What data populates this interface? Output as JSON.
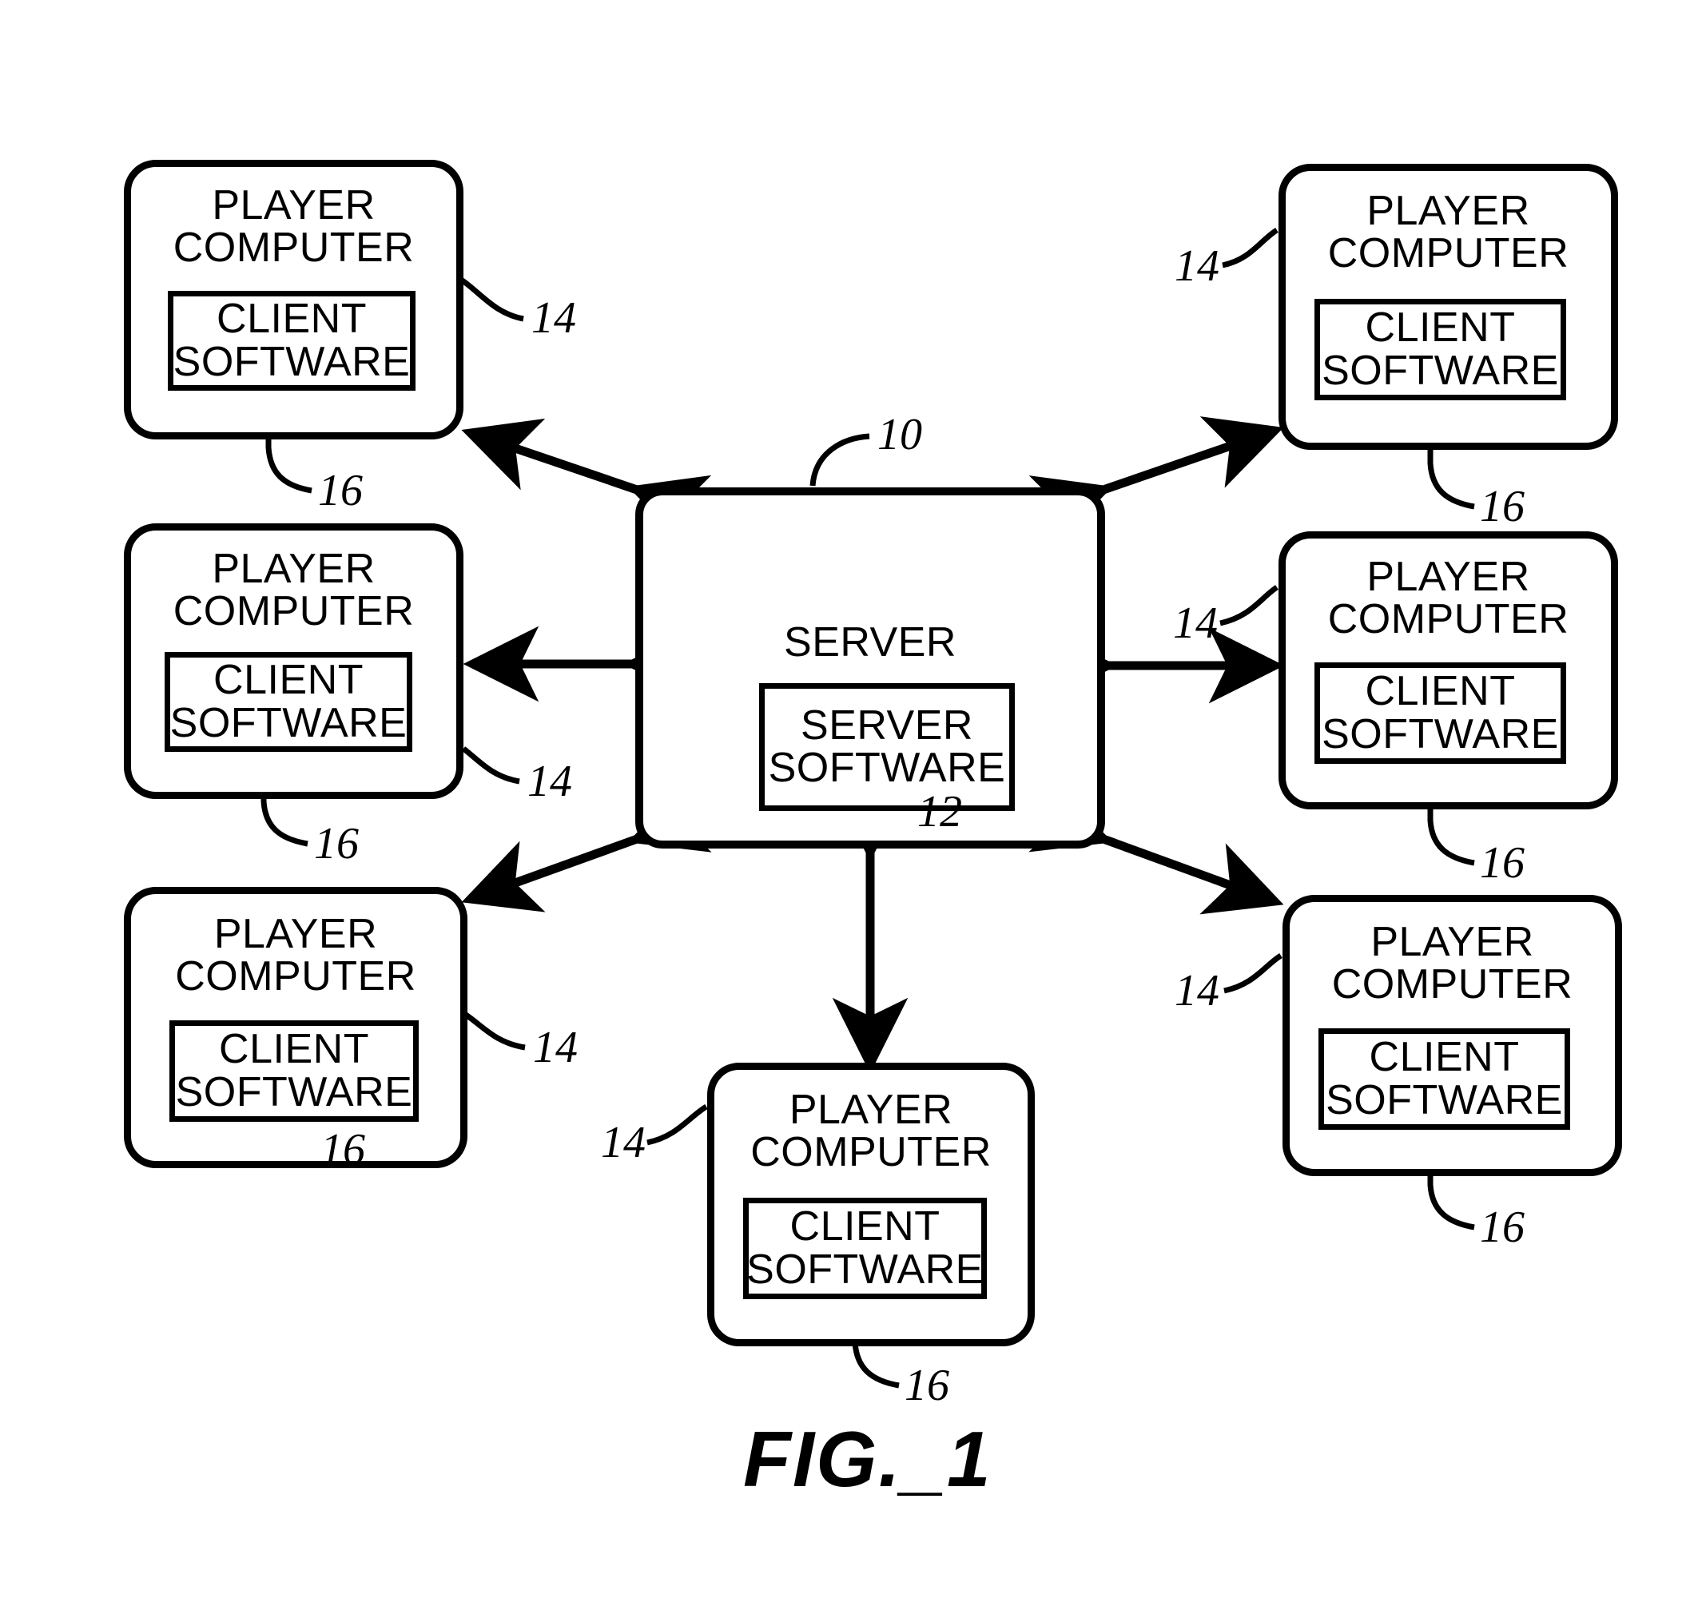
{
  "figure": {
    "caption": "FIG._1",
    "server": {
      "title": "SERVER",
      "inner_label": "SERVER\nSOFTWARE",
      "ref_outer": "10",
      "ref_inner": "12"
    },
    "player_title": "PLAYER\nCOMPUTER",
    "client_label": "CLIENT\nSOFTWARE",
    "ref_player": "14",
    "ref_client": "16",
    "nodes": [
      {
        "id": "player-top-left",
        "title": "PLAYER\nCOMPUTER",
        "inner_label": "CLIENT\nSOFTWARE",
        "ref_outer": "14",
        "ref_inner": "16"
      },
      {
        "id": "player-middle-left",
        "title": "PLAYER\nCOMPUTER",
        "inner_label": "CLIENT\nSOFTWARE",
        "ref_outer": "14",
        "ref_inner": "16"
      },
      {
        "id": "player-bottom-left",
        "title": "PLAYER\nCOMPUTER",
        "inner_label": "CLIENT\nSOFTWARE",
        "ref_outer": "14",
        "ref_inner": "16"
      },
      {
        "id": "player-top-right",
        "title": "PLAYER\nCOMPUTER",
        "inner_label": "CLIENT\nSOFTWARE",
        "ref_outer": "14",
        "ref_inner": "16"
      },
      {
        "id": "player-middle-right",
        "title": "PLAYER\nCOMPUTER",
        "inner_label": "CLIENT\nSOFTWARE",
        "ref_outer": "14",
        "ref_inner": "16"
      },
      {
        "id": "player-bottom-right",
        "title": "PLAYER\nCOMPUTER",
        "inner_label": "CLIENT\nSOFTWARE",
        "ref_outer": "14",
        "ref_inner": "16"
      },
      {
        "id": "player-bottom-center",
        "title": "PLAYER\nCOMPUTER",
        "inner_label": "CLIENT\nSOFTWARE",
        "ref_outer": "14",
        "ref_inner": "16"
      }
    ],
    "colors": {
      "ink": "#000000",
      "paper": "#ffffff"
    }
  }
}
